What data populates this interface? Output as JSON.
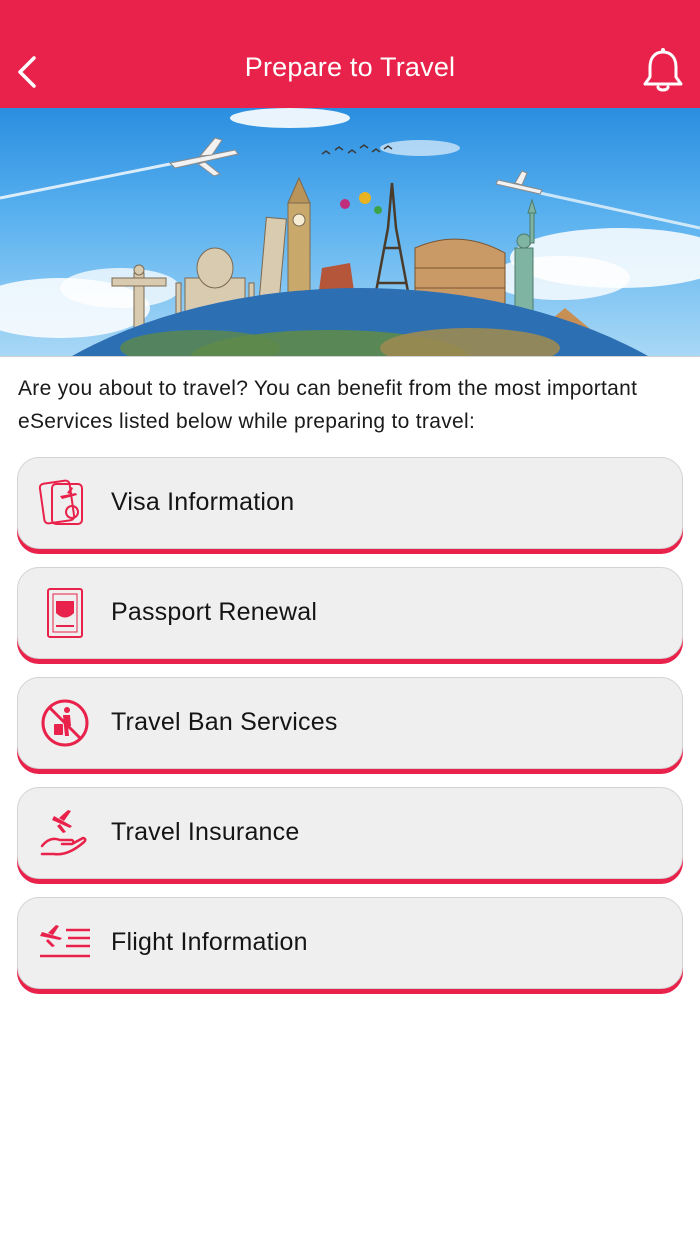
{
  "header": {
    "title": "Prepare to Travel",
    "back_icon": "chevron-left-icon",
    "notification_icon": "bell-icon",
    "background": "#e8224a"
  },
  "banner": {
    "image": "travel-landmarks-globe-banner"
  },
  "intro": {
    "text": "Are you about to travel? You can benefit from the most important eServices listed below while preparing to travel:"
  },
  "services": [
    {
      "label": "Visa Information",
      "icon": "visa-icon"
    },
    {
      "label": "Passport Renewal",
      "icon": "passport-icon"
    },
    {
      "label": "Travel Ban Services",
      "icon": "travel-ban-icon"
    },
    {
      "label": "Travel Insurance",
      "icon": "travel-insurance-icon"
    },
    {
      "label": "Flight Information",
      "icon": "flight-info-icon"
    }
  ],
  "colors": {
    "accent": "#e8224a",
    "card_background": "#efefef"
  }
}
